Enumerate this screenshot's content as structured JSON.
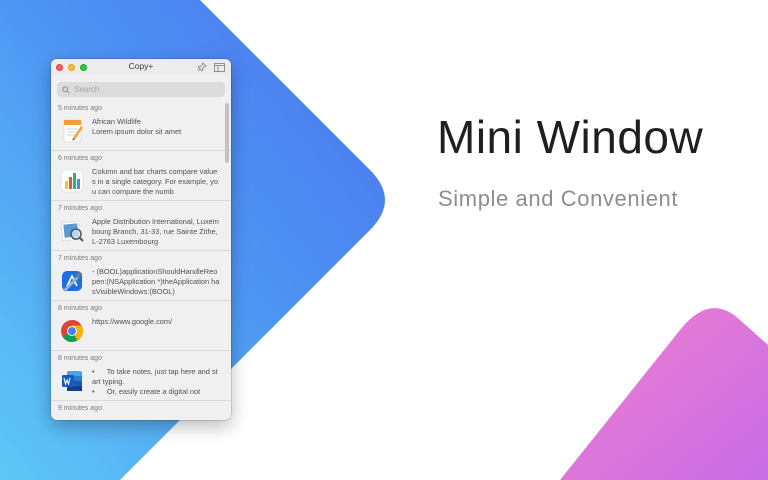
{
  "colors": {
    "blue_light": "#5ab4f5",
    "blue_dark": "#4a7cf2",
    "pink": "#ea7bd3",
    "purple": "#c46ee8"
  },
  "headline": "Mini Window",
  "subheadline": "Simple and Convenient",
  "window": {
    "title": "Copy+",
    "search_placeholder": "Search",
    "items": [
      {
        "time": "5 minutes ago",
        "app_icon": "pages-icon",
        "text": "African Wildlife\nLorem ipsum dolor sit amet"
      },
      {
        "time": "6 minutes ago",
        "app_icon": "numbers-icon",
        "text": "Column and bar charts compare values in a single category. For example, you can compare the numb"
      },
      {
        "time": "7 minutes ago",
        "app_icon": "preview-icon",
        "text": "Apple Distribution International, Luxembourg Branch, 31-33, rue Sainte Zithe, L-2763 Luxembourg"
      },
      {
        "time": "7 minutes ago",
        "app_icon": "xcode-icon",
        "text": "- (BOOL)applicationShouldHandleReopen:(NSApplication *)theApplication hasVisibleWindows:(BOOL)"
      },
      {
        "time": "8 minutes ago",
        "app_icon": "chrome-icon",
        "text": "https://www.google.com/"
      },
      {
        "time": "8 minutes ago",
        "app_icon": "word-icon",
        "text": "•      To take notes, just tap here and start typing.\n•      Or, easily create a digital not"
      },
      {
        "time": "9 minutes ago",
        "app_icon": "",
        "text": ""
      }
    ]
  }
}
